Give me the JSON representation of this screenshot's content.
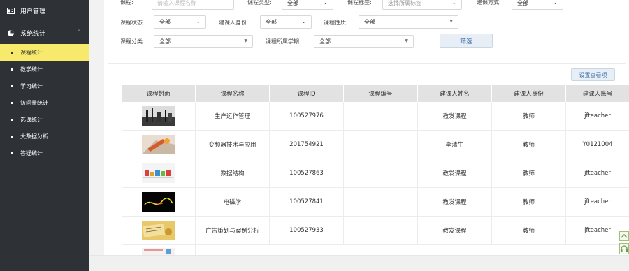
{
  "sidebar": {
    "user_mgmt": "用户管理",
    "system_stats": "系统统计",
    "items": [
      {
        "label": "课程统计",
        "active": true
      },
      {
        "label": "教学统计",
        "active": false
      },
      {
        "label": "学习统计",
        "active": false
      },
      {
        "label": "访问量统计",
        "active": false
      },
      {
        "label": "选课统计",
        "active": false
      },
      {
        "label": "大数据分析",
        "active": false
      },
      {
        "label": "答疑统计",
        "active": false
      }
    ]
  },
  "filters": {
    "course_label": "课程:",
    "course_placeholder": "请输入课程名称",
    "type_label": "课程类型:",
    "type_value": "全部",
    "tag_label": "课程标签:",
    "tag_placeholder": "选择所属标签",
    "build_label": "建课方式:",
    "build_value": "全部",
    "status_label": "课程状态:",
    "status_value": "全部",
    "identity_label": "建课人身份:",
    "identity_value": "全部",
    "nature_label": "课程性质:",
    "nature_value": "全部",
    "category_label": "课程分类:",
    "category_value": "全部",
    "term_label": "课程所属学期:",
    "term_value": "全部",
    "filter_button": "筛选"
  },
  "settings_button": "设置查看项",
  "table": {
    "headers": [
      "课程封面",
      "课程名称",
      "课程ID",
      "课程编号",
      "建课人姓名",
      "建课人身份",
      "建课人账号"
    ],
    "rows": [
      {
        "name": "生产运作管理",
        "id": "100527976",
        "code": "",
        "creator": "教发课程",
        "identity": "教师",
        "account": "jfteacher"
      },
      {
        "name": "变频器技术与应用",
        "id": "201754921",
        "code": "",
        "creator": "李清生",
        "identity": "教师",
        "account": "Y0121004"
      },
      {
        "name": "数据结构",
        "id": "100527863",
        "code": "",
        "creator": "教发课程",
        "identity": "教师",
        "account": "jfteacher"
      },
      {
        "name": "电磁学",
        "id": "100527841",
        "code": "",
        "creator": "教发课程",
        "identity": "教师",
        "account": "jfteacher"
      },
      {
        "name": "广告策划与案例分析",
        "id": "100527933",
        "code": "",
        "creator": "教发课程",
        "identity": "教师",
        "account": "jfteacher"
      }
    ]
  },
  "icons": {
    "user": "id-card-icon",
    "stats": "pie-chart-icon",
    "up": "chevron-up-icon",
    "support": "headset-icon"
  },
  "colors": {
    "sidebar_bg": "#2e3237",
    "active_bg": "#f7e96b",
    "button_bg": "#e7eef6",
    "button_text": "#3a6ea5"
  }
}
